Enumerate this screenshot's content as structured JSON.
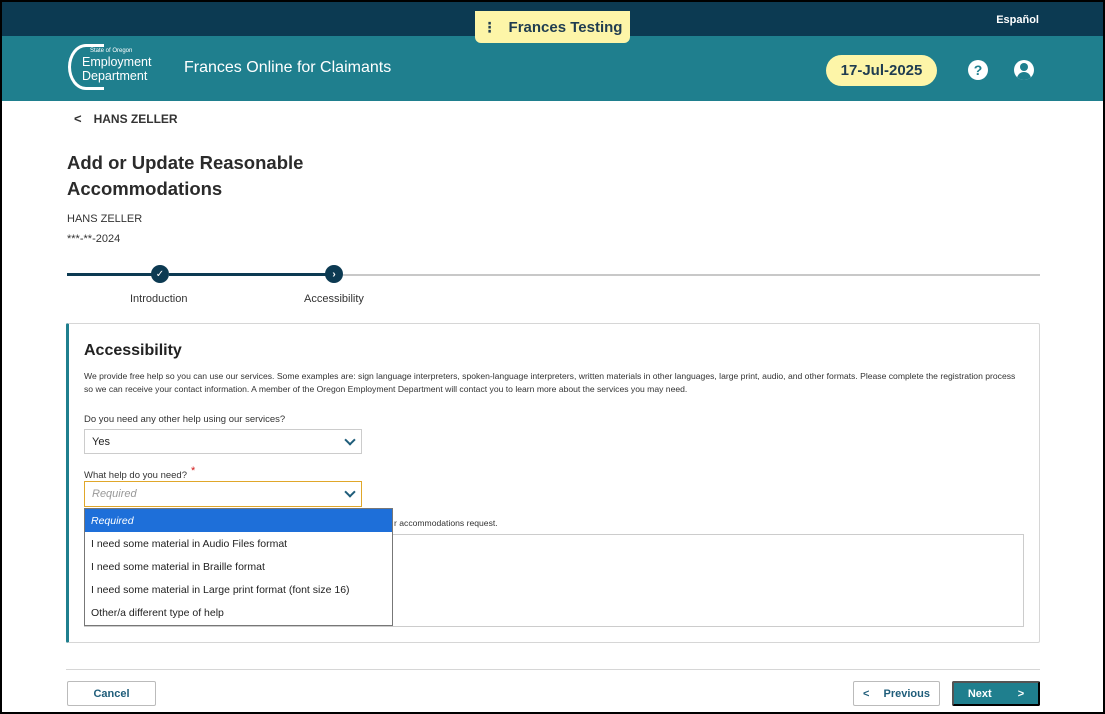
{
  "env_banner": {
    "label": "Frances Testing",
    "menu_glyph": "⋮"
  },
  "top_bar": {
    "language_link": "Español"
  },
  "header": {
    "logo_small": "State of Oregon",
    "logo_line1": "Employment",
    "logo_line2": "Department",
    "app_title": "Frances Online for Claimants",
    "date": "17-Jul-2025",
    "help_glyph": "?"
  },
  "breadcrumb": {
    "back_label": "HANS ZELLER",
    "chevron": "<"
  },
  "page": {
    "title": "Add or Update Reasonable Accommodations",
    "claimant_name": "HANS ZELLER",
    "claimant_ssn": "***-**-2024"
  },
  "stepper": {
    "steps": [
      {
        "label": "Introduction",
        "status": "complete",
        "glyph": "✓"
      },
      {
        "label": "Accessibility",
        "status": "current",
        "glyph": "›"
      }
    ]
  },
  "accessibility": {
    "heading": "Accessibility",
    "description": "We provide free help so you can use our services. Some examples are: sign language interpreters, spoken-language interpreters, written materials in other languages, large print, audio, and other formats. Please complete the registration process so we can receive your contact information. A member of the Oregon Employment Department will contact you to learn more about the services you may need.",
    "q1_label": "Do you need any other help using our services?",
    "q1_value": "Yes",
    "q2_label": "What help do you need?",
    "q2_required_mark": "*",
    "q2_placeholder": "Required",
    "partial_hidden_text": "r accommodations request.",
    "q2_options": [
      "Required",
      "I need some material in Audio Files format",
      "I need some material in Braille format",
      "I need some material in Large print format (font size 16)",
      "Other/a different type of help"
    ]
  },
  "footer": {
    "cancel_label": "Cancel",
    "previous_label": "Previous",
    "next_label": "Next",
    "prev_chevron": "<",
    "next_chevron": ">"
  },
  "colors": {
    "header_teal": "#1f7f8e",
    "navy": "#0c3a52",
    "highlight_yellow": "#fdf5a8",
    "dropdown_selected": "#1e6fd9",
    "required_red": "#d21919"
  }
}
